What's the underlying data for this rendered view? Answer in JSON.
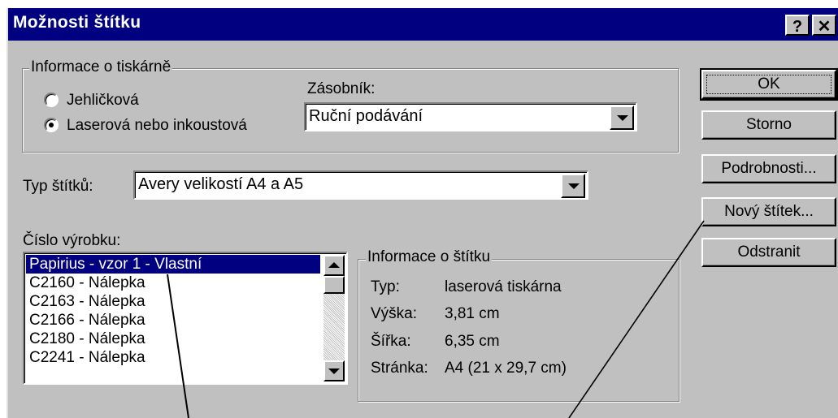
{
  "window": {
    "title": "Možnosti štítku",
    "help_btn": "?",
    "close_btn": "✕"
  },
  "printer_info": {
    "legend": "Informace o tiskárně",
    "radio_dot_matrix": "Jehličková",
    "radio_laser": "Laserová nebo inkoustová",
    "selected": "Laserová nebo inkoustová",
    "tray_label": "Zásobník:",
    "tray_value": "Ruční podávání"
  },
  "label_type": {
    "label": "Typ štítků:",
    "value": "Avery velikostí A4 a A5"
  },
  "product_number": {
    "label": "Číslo výrobku:",
    "items": [
      "Papirius - vzor 1 - Vlastní",
      "C2160 - Nálepka",
      "C2163 - Nálepka",
      "C2166 - Nálepka",
      "C2180 - Nálepka",
      "C2241 - Nálepka"
    ],
    "selected_index": 0
  },
  "label_info": {
    "legend": "Informace o štítku",
    "rows": [
      {
        "key": "Typ:",
        "value": "laserová tiskárna"
      },
      {
        "key": "Výška:",
        "value": "3,81 cm"
      },
      {
        "key": "Šířka:",
        "value": "6,35 cm"
      },
      {
        "key": "Stránka:",
        "value": "A4 (21 x 29,7 cm)"
      }
    ]
  },
  "buttons": {
    "ok": "OK",
    "cancel": "Storno",
    "details": "Podrobnosti...",
    "new_label": "Nový štítek...",
    "delete": "Odstranit"
  }
}
